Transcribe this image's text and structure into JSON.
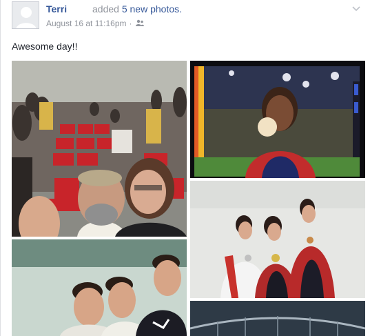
{
  "post": {
    "author": "Terri",
    "action_prefix": "added",
    "action_link": "5 new photos.",
    "timestamp": "August 16 at 11:16pm",
    "separator": "·",
    "audience_icon": "friends-icon",
    "menu_icon": "chevron-down-icon",
    "status_text": "Awesome day!!"
  },
  "colors": {
    "link": "#365899",
    "meta": "#90949c",
    "text": "#1d2129"
  }
}
